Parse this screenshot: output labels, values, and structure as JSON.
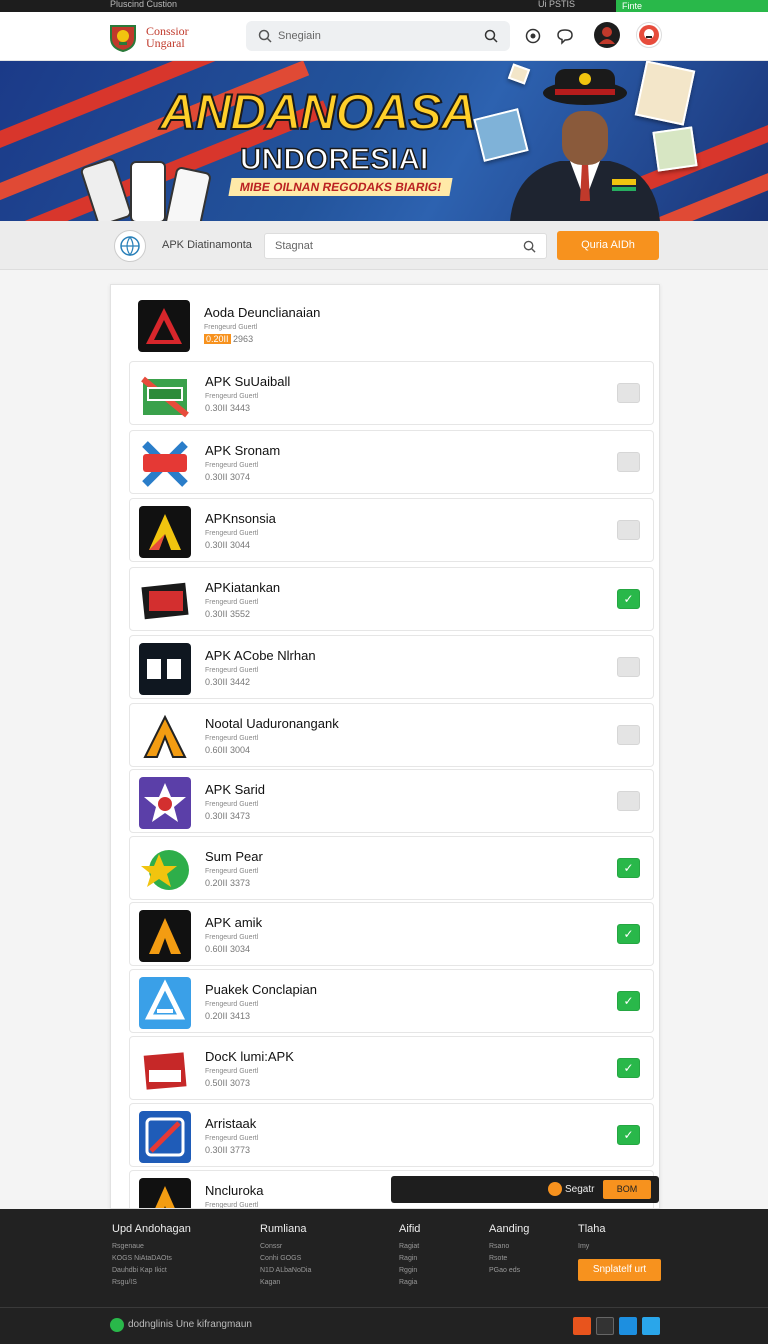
{
  "topbar": {
    "left_text": "Pluscind Custion",
    "right_text": "Ui PSTIS",
    "right_green": "Finte"
  },
  "header": {
    "brand_line1": "Conssior",
    "brand_line2": "Ungaral",
    "search_placeholder": "Snegiain"
  },
  "banner": {
    "title": "ANDANOASA",
    "subtitle": "UNDORESIAI",
    "tagline": "MIBE OILNAN  REGODAKS BIARIG!"
  },
  "subbar": {
    "label": "APK Diatinamonta",
    "search_placeholder": "Stagnat",
    "button": "Quria AIDh"
  },
  "apps": [
    {
      "title": "Aoda Deunclianaian",
      "sub": "Frengeurd Guertl",
      "meta_hl": "0.20II",
      "meta": "2963",
      "checked": null
    },
    {
      "title": "APK SuUaiball",
      "sub": "Frengeurd Guertl",
      "meta": "0.30II  3443",
      "checked": false
    },
    {
      "title": "APK Sronam",
      "sub": "Frengeurd Guertl",
      "meta": "0.30II  3074",
      "checked": false
    },
    {
      "title": "APKnsonsia",
      "sub": "Frengeurd Guertl",
      "meta": "0.30II  3044",
      "checked": false
    },
    {
      "title": "APKiatankan",
      "sub": "Frengeurd Guertl",
      "meta": "0.30II  3552",
      "checked": true
    },
    {
      "title": "APK ACobe Nlrhan",
      "sub": "Frengeurd Guertl",
      "meta": "0.30II  3442",
      "checked": false
    },
    {
      "title": "Nootal Uaduronangank",
      "sub": "Frengeurd Guertl",
      "meta": "0.60II  3004",
      "checked": false
    },
    {
      "title": "APK Sarid",
      "sub": "Frengeurd Guertl",
      "meta": "0.30II  3473",
      "checked": false
    },
    {
      "title": "Sum Pear",
      "sub": "Frengeurd Guertl",
      "meta": "0.20II  3373",
      "checked": true
    },
    {
      "title": "APK amik",
      "sub": "Frengeurd Guertl",
      "meta": "0.60II  3034",
      "checked": true
    },
    {
      "title": "Puakek Conclapian",
      "sub": "Frengeurd Guertl",
      "meta": "0.20II  3413",
      "checked": true
    },
    {
      "title": "DocK lumi:APK",
      "sub": "Frengeurd Guertl",
      "meta": "0.50II  3073",
      "checked": true
    },
    {
      "title": "Arristaak",
      "sub": "Frengeurd Guertl",
      "meta": "0.30II  3773",
      "checked": true
    },
    {
      "title": "Nncluroka",
      "sub": "Frengeurd Guertl",
      "meta": "",
      "checked": null
    }
  ],
  "floatbar": {
    "label": "Segatr",
    "button": "BOM"
  },
  "footer": {
    "columns": [
      {
        "heading": "Upd Andohagan",
        "links": [
          "Rsgenaue",
          "KOGS NiAtaDAOts",
          "Dauhdbi Kap Ikict",
          "Rsgu/IS"
        ]
      },
      {
        "heading": "Rumliana",
        "links": [
          "Conssr",
          "Conhi GOGS",
          "N1D ALbaNoDia",
          "Kagan"
        ]
      },
      {
        "heading": "Aifid",
        "links": [
          "Ragiat",
          "Ragin",
          "Rggin",
          "Ragia"
        ]
      },
      {
        "heading": "Aanding",
        "links": [
          "Rsano",
          "Rsote",
          "PGao eds"
        ]
      },
      {
        "heading": "Tlaha",
        "links": [
          "Imy"
        ]
      }
    ],
    "cta": "Snplatelf urt",
    "bottom_text": "dodnglinis Une kifrangmaun"
  }
}
